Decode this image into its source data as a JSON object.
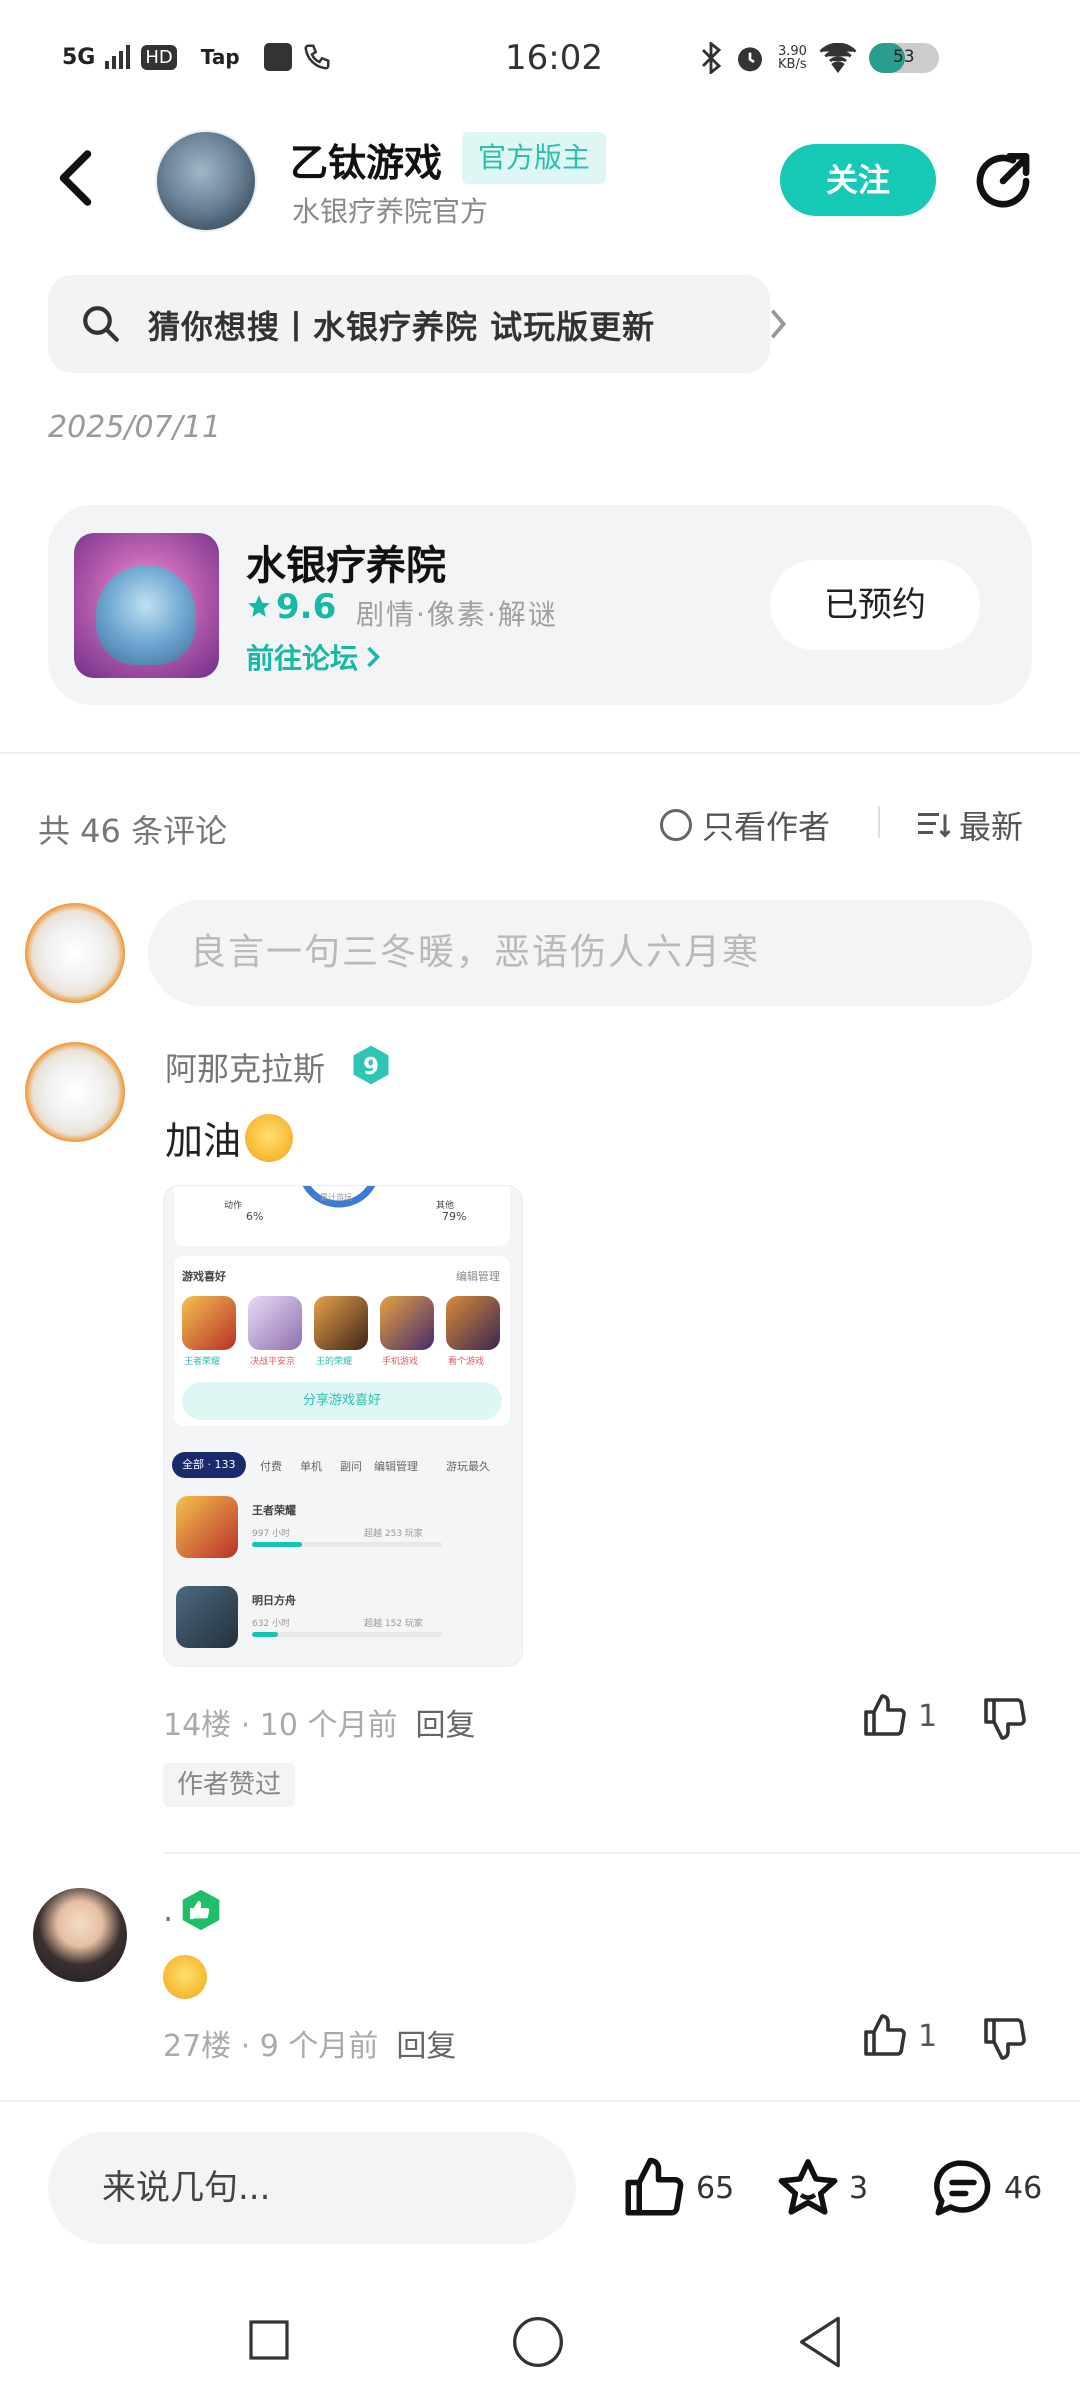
{
  "status_bar": {
    "network": "5G",
    "hd": "HD",
    "tap": "Tap",
    "time": "16:02",
    "net_speed": "3.90",
    "net_speed_unit": "KB/s",
    "battery": "53"
  },
  "header": {
    "author_name": "乙钛游戏",
    "author_badge": "官方版主",
    "author_subtitle": "水银疗养院官方",
    "follow_label": "关注"
  },
  "search": {
    "text": "猜你想搜丨水银疗养院 试玩版更新"
  },
  "post": {
    "date": "2025/07/11"
  },
  "game_card": {
    "name": "水银疗养院",
    "rating": "9.6",
    "tags": "剧情·像素·解谜",
    "forum_link": "前往论坛",
    "reserve_label": "已预约"
  },
  "comments_toolbar": {
    "count_label": "共 46 条评论",
    "only_author": "只看作者",
    "sort_label": "最新"
  },
  "composer": {
    "placeholder": "良言一句三冬暖，恶语伤人六月寒"
  },
  "comments": [
    {
      "username": "阿那克拉斯",
      "level": "9",
      "text": "加油",
      "meta": "14楼 · 10 个月前",
      "reply_label": "回复",
      "likes": "1",
      "badge": "作者赞过",
      "screenshot": {
        "stat_left_label": "动作",
        "stat_left_value": "6%",
        "stat_center_label": "累计游玩",
        "stat_right_label": "其他",
        "stat_right_value": "79%",
        "section_title": "游戏喜好",
        "section_action": "编辑管理",
        "games": [
          "王者荣耀",
          "决战平安京",
          "王的荣耀",
          "手机游戏",
          "看个游戏"
        ],
        "share_button": "分享游戏喜好",
        "tabs": [
          "全部 · 133",
          "付费",
          "单机",
          "副问",
          "编辑管理",
          "游玩最久"
        ],
        "list_items": [
          {
            "name": "王者荣耀",
            "playtime": "997 小时",
            "extra": "超越 253 玩家"
          },
          {
            "name": "明日方舟",
            "playtime": "632 小时",
            "extra": "超越 152 玩家"
          }
        ]
      }
    },
    {
      "username": ".",
      "text": "",
      "meta": "27楼 · 9 个月前",
      "reply_label": "回复",
      "likes": "1"
    }
  ],
  "bottom_bar": {
    "input_placeholder": "来说几句...",
    "likes": "65",
    "favorites": "3",
    "comments": "46"
  },
  "colors": {
    "accent": "#16c9b6",
    "accent_text": "#16b8a6",
    "muted": "#9a9a9a",
    "card_bg": "#f3f4f6"
  }
}
